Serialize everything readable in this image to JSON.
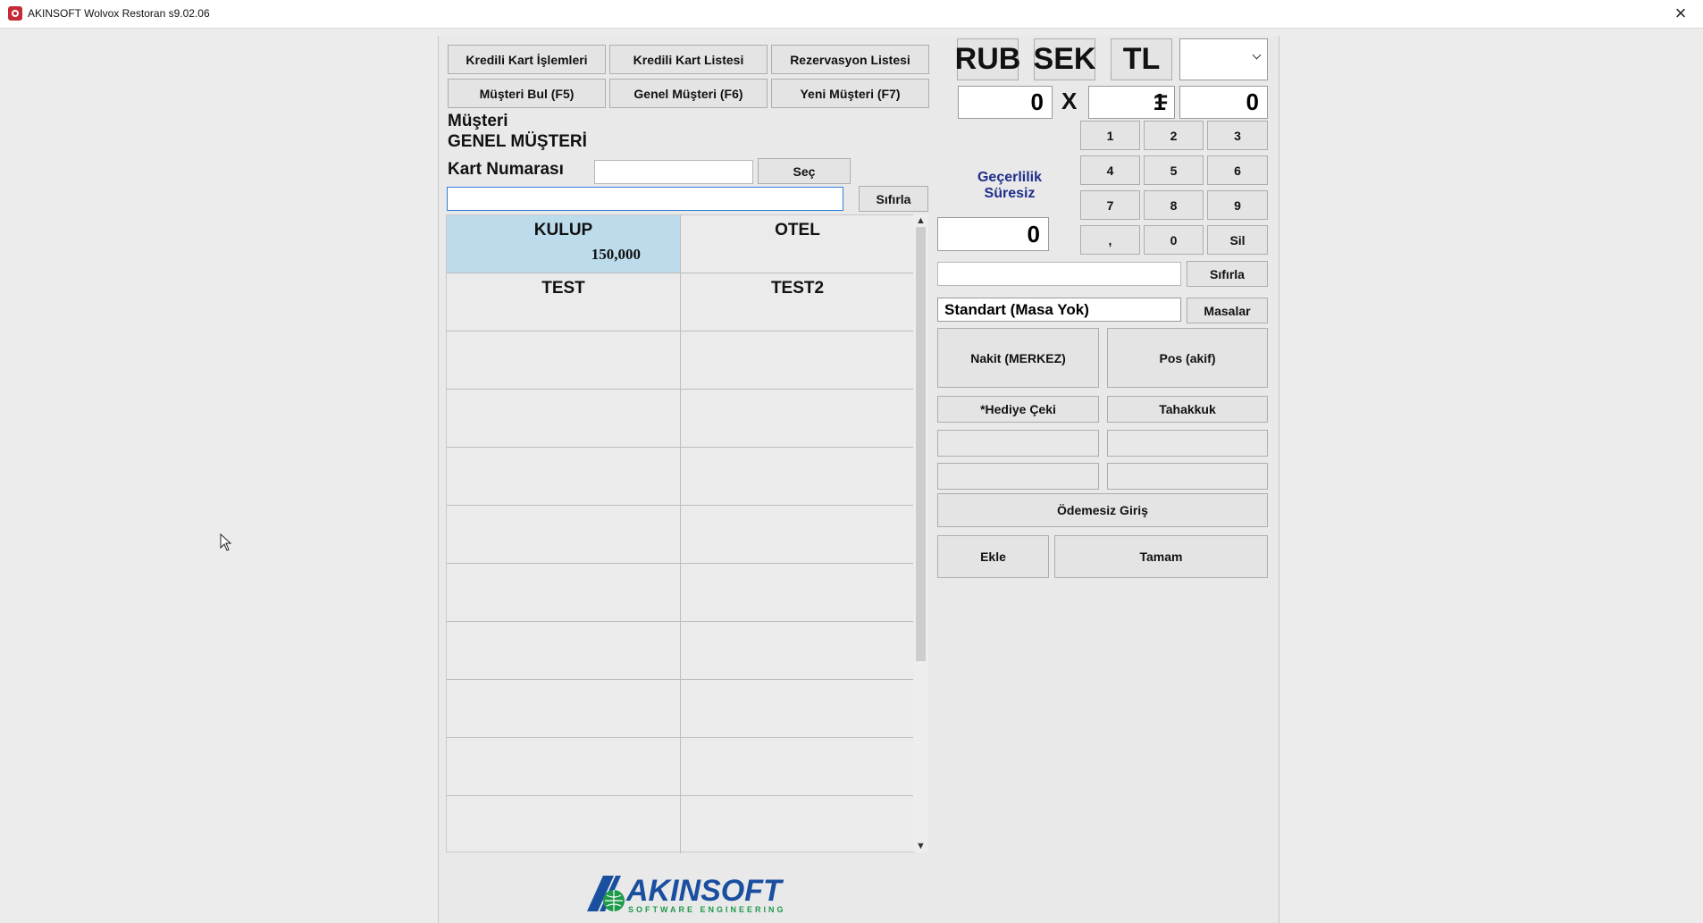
{
  "window": {
    "title": "AKINSOFT Wolvox Restoran s9.02.06"
  },
  "top_buttons": {
    "kredili_kart_islemleri": "Kredili Kart İşlemleri",
    "kredili_kart_listesi": "Kredili Kart Listesi",
    "rezervasyon_listesi": "Rezervasyon Listesi",
    "musteri_bul": "Müşteri Bul (F5)",
    "genel_musteri": "Genel Müşteri (F6)",
    "yeni_musteri": "Yeni Müşteri (F7)"
  },
  "customer": {
    "label": "Müşteri",
    "name": "GENEL MÜŞTERİ",
    "card_label": "Kart Numarası",
    "card_value": "",
    "select_label": "Seç",
    "search_value": "",
    "reset_label": "Sıfırla"
  },
  "groups": [
    {
      "name": "KULUP",
      "value": "150,000",
      "selected": true
    },
    {
      "name": "OTEL",
      "value": ""
    },
    {
      "name": "TEST",
      "value": ""
    },
    {
      "name": "TEST2",
      "value": ""
    }
  ],
  "currency": {
    "buttons": [
      "RUB",
      "SEK",
      "TL"
    ],
    "dropdown_value": "",
    "amount": "0",
    "multiply_symbol": "X",
    "rate": "1",
    "equals_symbol": "=",
    "result": "0"
  },
  "validity": {
    "line1": "Geçerlilik",
    "line2": "Süresiz",
    "color": "#1f2e8a"
  },
  "amount_display": "0",
  "keypad": {
    "keys": [
      "1",
      "2",
      "3",
      "4",
      "5",
      "6",
      "7",
      "8",
      "9",
      ",",
      "0",
      "Sil"
    ],
    "reset_label": "Sıfırla",
    "note_value": ""
  },
  "table": {
    "value": "Standart (Masa Yok)",
    "button": "Masalar"
  },
  "payments": {
    "nakit": "Nakit (MERKEZ)",
    "pos": "Pos (akif)",
    "hediye_ceki": "*Hediye Çeki",
    "tahakkuk": "Tahakkuk",
    "odemesiz_giris": "Ödemesiz Giriş",
    "ekle": "Ekle",
    "tamam": "Tamam"
  },
  "logo": {
    "brand": "AKINSOFT",
    "tagline": "SOFTWARE ENGINEERING",
    "color": "#1a4fa0",
    "accent": "#1d9a4a"
  }
}
